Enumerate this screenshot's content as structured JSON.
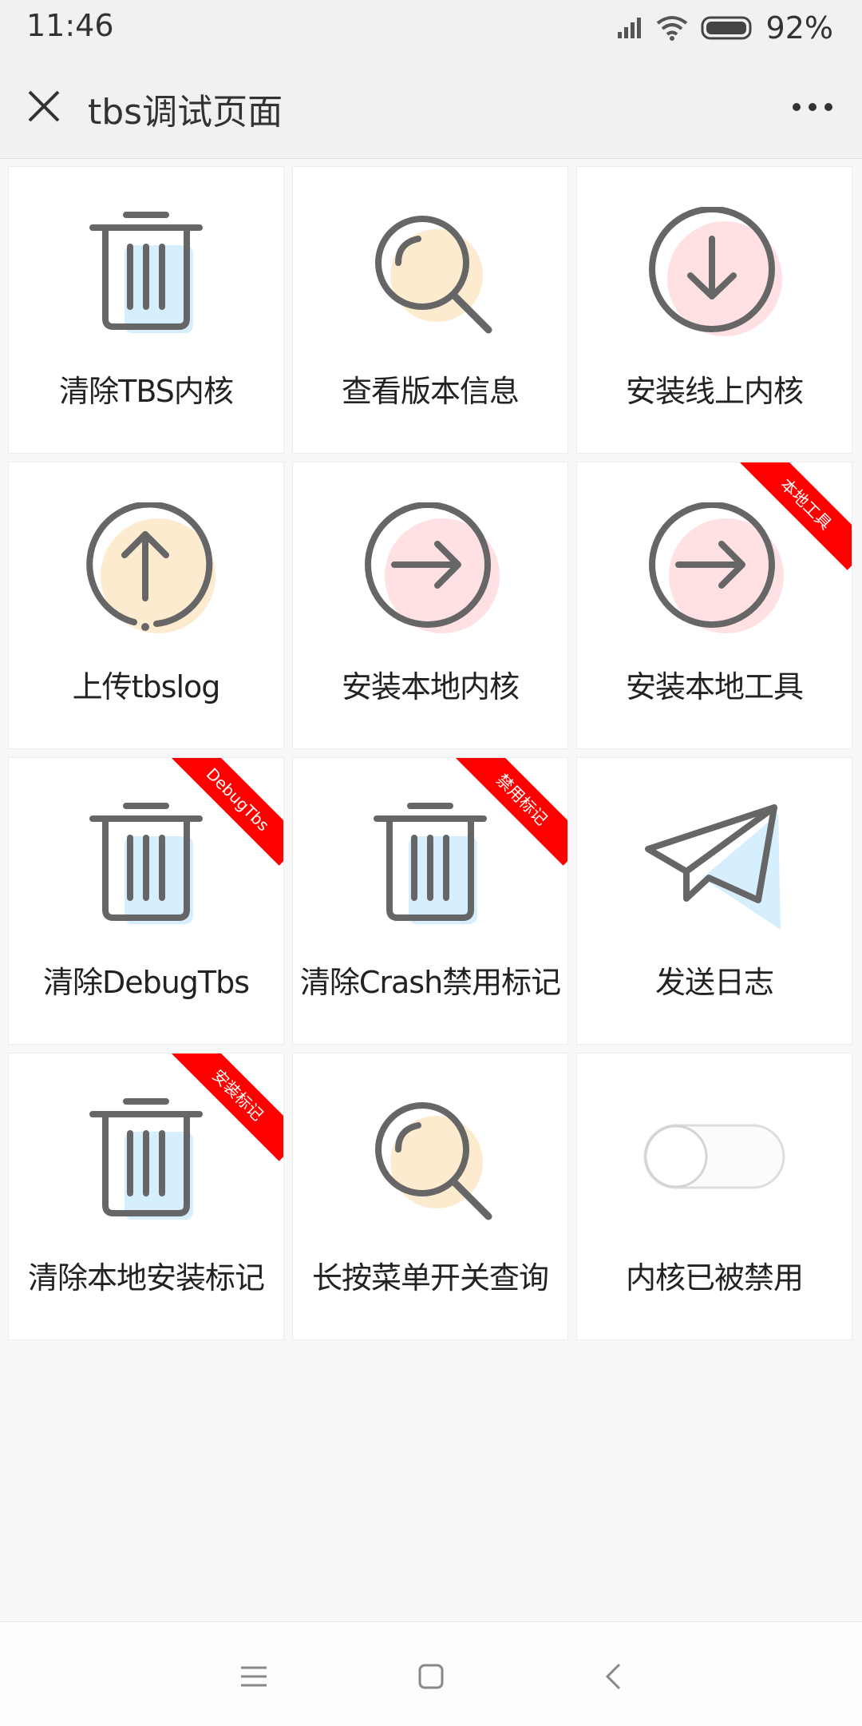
{
  "status": {
    "time": "11:46",
    "battery": "92%"
  },
  "header": {
    "title": "tbs调试页面"
  },
  "tiles": [
    {
      "label": "清除TBS内核",
      "icon": "trash-icon"
    },
    {
      "label": "查看版本信息",
      "icon": "search-icon"
    },
    {
      "label": "安装线上内核",
      "icon": "download-circle-icon"
    },
    {
      "label": "上传tbslog",
      "icon": "upload-circle-icon"
    },
    {
      "label": "安装本地内核",
      "icon": "arrow-right-circle-icon"
    },
    {
      "label": "安装本地工具",
      "icon": "arrow-right-circle-icon",
      "badge": "本地工具"
    },
    {
      "label": "清除DebugTbs",
      "icon": "trash-icon",
      "badge": "DebugTbs"
    },
    {
      "label": "清除Crash禁用标记",
      "icon": "trash-icon",
      "badge": "禁用标记"
    },
    {
      "label": "发送日志",
      "icon": "paper-plane-icon"
    },
    {
      "label": "清除本地安装标记",
      "icon": "trash-icon",
      "badge": "安装标记"
    },
    {
      "label": "长按菜单开关查询",
      "icon": "search-icon"
    },
    {
      "label": "内核已被禁用",
      "icon": "toggle-switch",
      "toggle_on": false
    }
  ],
  "colors": {
    "icon_stroke": "#666666",
    "accent_blue": "#d6efff",
    "accent_orange": "#fdebd0",
    "accent_pink": "#ffe1e4",
    "badge_red": "#ff0000"
  }
}
